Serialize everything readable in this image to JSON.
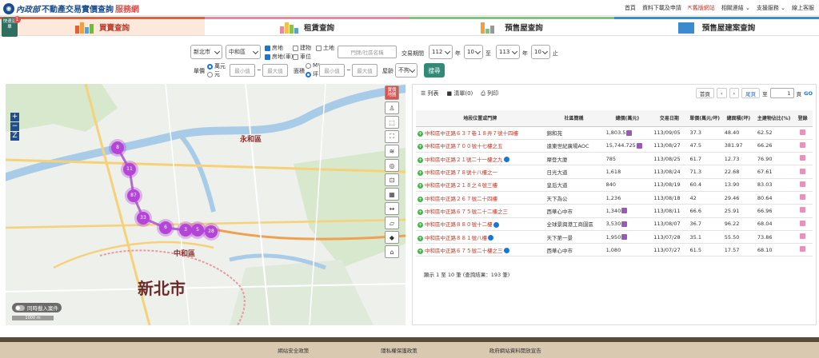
{
  "header": {
    "brand": "內政部",
    "title": "不動產交易實價查詢",
    "title_suffix": "服務網",
    "nav": [
      "首頁",
      "資料下載及申請",
      "舊版網站",
      "相關連結",
      "支援服務",
      "線上客服"
    ]
  },
  "quick_button": {
    "label": "快速選單",
    "badge": "1"
  },
  "tabs": [
    {
      "label": "買賣查詢",
      "active": true
    },
    {
      "label": "租賃查詢",
      "active": false
    },
    {
      "label": "預售屋查詢",
      "active": false
    },
    {
      "label": "預售屋建案查詢",
      "active": false
    }
  ],
  "filters": {
    "city": "新北市",
    "district": "中和區",
    "types": [
      {
        "label": "房地",
        "checked": true
      },
      {
        "label": "建物",
        "checked": false
      },
      {
        "label": "土地",
        "checked": false
      },
      {
        "label": "房地(車)",
        "checked": true
      },
      {
        "label": "車位",
        "checked": false
      }
    ],
    "keyword_placeholder": "門牌/社區名稱",
    "period_label": "交易期間",
    "year_from": "112",
    "month_from": "10",
    "year_to": "113",
    "month_to": "10",
    "year_unit": "年",
    "to_label": "至",
    "end_label": "止",
    "price_label": "單價",
    "price_units": [
      "萬元",
      "元"
    ],
    "min_placeholder": "最小值",
    "max_placeholder": "最大值",
    "area_label": "面積",
    "area_units": [
      "M²",
      "坪"
    ],
    "age_label": "屋齡",
    "age_value": "不拘",
    "search_button": "搜尋"
  },
  "map": {
    "toggle_label": "同時載入案件",
    "tool_top": "實價地圖",
    "labels": [
      "永和區",
      "中和區",
      "新北市"
    ],
    "clusters": [
      "8",
      "11",
      "87",
      "33",
      "6",
      "3",
      "5",
      "28"
    ],
    "scale": "1000 m"
  },
  "results": {
    "list_label": "列表",
    "cart_label": "清單(0)",
    "print_label": "列印",
    "pager": {
      "first": "首頁",
      "last": "尾頁",
      "page_prefix": "至",
      "page": "1",
      "page_suffix": "頁",
      "go": "GO"
    },
    "columns": [
      "地段位置或門牌",
      "社區簡稱",
      "總價(萬元)",
      "交易日期",
      "單價(萬元/坪)",
      "總面積(坪)",
      "主建物佔比(%)",
      "登錄"
    ],
    "rows": [
      [
        "中和區中正路６３７巷１８弄７號十四樓",
        "錦和苑",
        "1,803.5",
        "113/09/05",
        "37.3",
        "48.40",
        "62.52"
      ],
      [
        "中和區中正路７００號十七樓之五",
        "遠東世紀廣場AOC",
        "15,744.725",
        "113/08/27",
        "47.5",
        "381.97",
        "66.26"
      ],
      [
        "中和區中正路２１號二十一樓之九",
        "摩登大廈",
        "785",
        "113/08/25",
        "61.7",
        "12.73",
        "76.90"
      ],
      [
        "中和區中正路７８號十八樓之一",
        "日光大道",
        "1,618",
        "113/08/24",
        "71.3",
        "22.68",
        "67.61"
      ],
      [
        "中和區中正路２１８之４號三樓",
        "皇后大道",
        "840",
        "113/08/19",
        "60.4",
        "13.90",
        "83.03"
      ],
      [
        "中和區中正路２６７號二十四樓",
        "天下為公",
        "1,236",
        "113/08/18",
        "42",
        "29.46",
        "80.64"
      ],
      [
        "中和區中正路６７５號二十二樓之三",
        "西華心中市",
        "1,340",
        "113/08/11",
        "66.6",
        "25.91",
        "66.96"
      ],
      [
        "中和區中正路８８０號十二樓",
        "全球景興港工商園區",
        "3,530",
        "113/08/07",
        "36.7",
        "96.22",
        "68.04"
      ],
      [
        "中和區中正路８８１號八樓",
        "天下第一景",
        "1,950",
        "113/07/28",
        "35.1",
        "55.50",
        "73.86"
      ],
      [
        "中和區中正路６７５號二十樓之三",
        "西華心中市",
        "1,080",
        "113/07/27",
        "61.5",
        "17.57",
        "68.10"
      ]
    ],
    "summary": "顯示 1 至 10 筆 (查詢結果：193 筆)"
  },
  "footer": [
    "網站安全政策",
    "隱私權保護政策",
    "政府網站資料開放宣告"
  ]
}
